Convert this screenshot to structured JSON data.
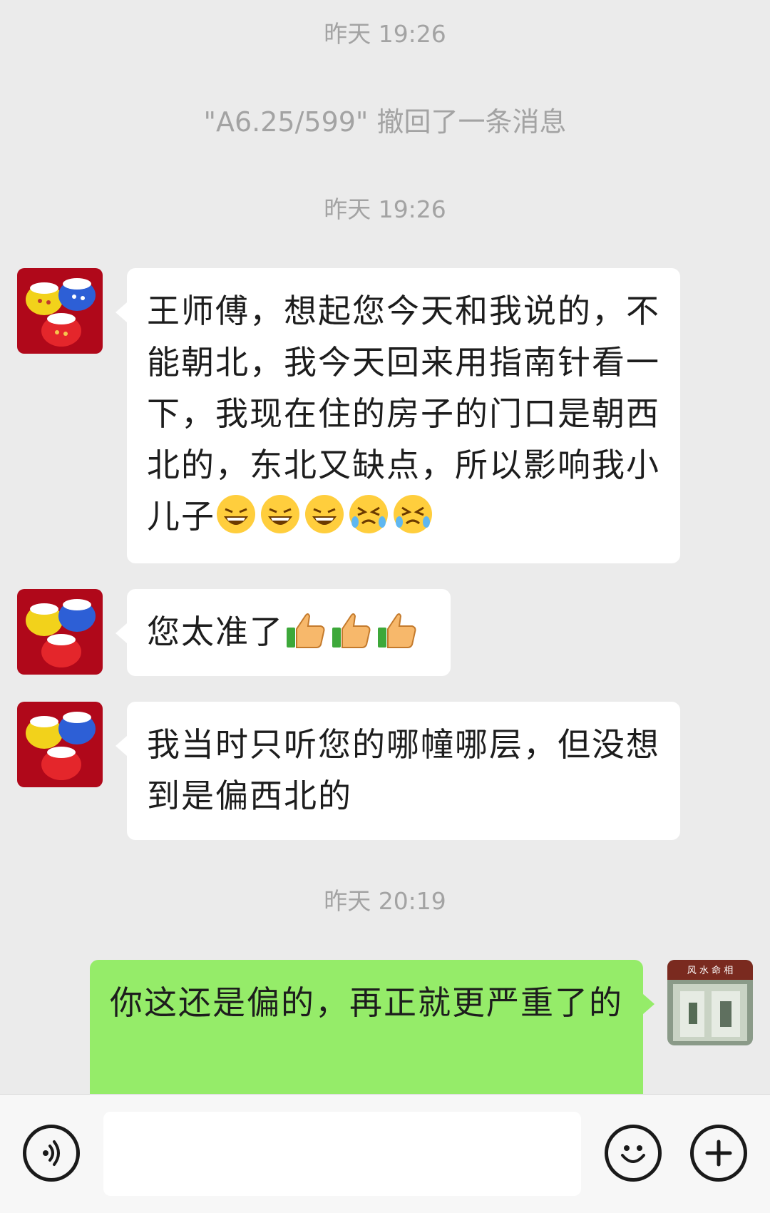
{
  "messages": {
    "ts1": "昨天 19:26",
    "recall_notice": "\"A6.25/599\" 撤回了一条消息",
    "ts2": "昨天 19:26",
    "msg1_text": "王师傅，想起您今天和我说的，不能朝北，我今天回来用指南针看一下，我现在住的房子的门口是朝西北的，东北又缺点，所以影响我小儿子",
    "msg1_emojis": [
      "grin-sweat-emoji",
      "grin-sweat-emoji",
      "grin-sweat-emoji",
      "crying-emoji",
      "crying-emoji"
    ],
    "msg2_text": "您太准了",
    "msg2_emojis": [
      "thumbs-up-emoji",
      "thumbs-up-emoji",
      "thumbs-up-emoji"
    ],
    "msg3_text": "我当时只听您的哪幢哪层，但没想到是偏西北的",
    "ts3": "昨天 20:19",
    "msg4_text": "你这还是偏的，再正就更严重了的",
    "my_avatar_sign": "风 水 命 相"
  },
  "input_bar": {
    "placeholder": "",
    "voice_icon": "voice-icon",
    "emoji_icon": "smiley-icon",
    "plus_icon": "plus-icon"
  },
  "colors": {
    "background": "#ebebeb",
    "incoming_bubble": "#ffffff",
    "outgoing_bubble": "#95ec69",
    "timestamp_text": "#a3a3a3"
  }
}
